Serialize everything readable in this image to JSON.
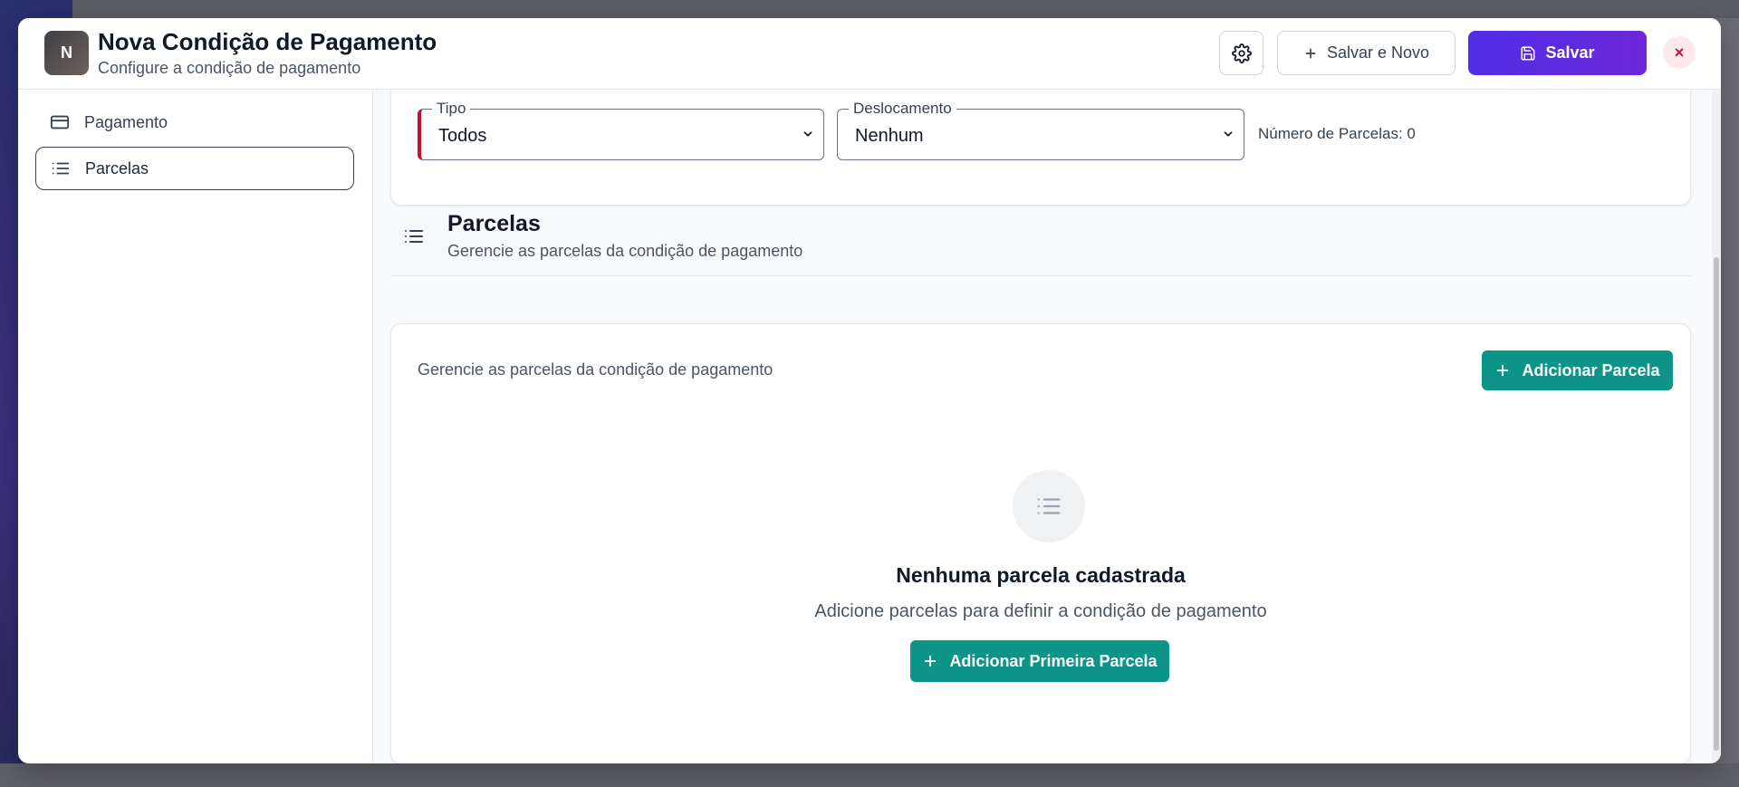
{
  "header": {
    "avatar_letter": "N",
    "title": "Nova Condição de Pagamento",
    "subtitle": "Configure a condição de pagamento",
    "save_new_label": "Salvar e Novo",
    "save_label": "Salvar",
    "close_label": "×"
  },
  "sidebar": {
    "items": [
      {
        "label": "Pagamento",
        "icon": "credit-card-icon",
        "active": false
      },
      {
        "label": "Parcelas",
        "icon": "list-icon",
        "active": true
      }
    ]
  },
  "filters": {
    "tipo": {
      "label": "Tipo",
      "value": "Todos"
    },
    "deslocamento": {
      "label": "Deslocamento",
      "value": "Nenhum"
    },
    "numero_parcelas": "Número de Parcelas: 0"
  },
  "section": {
    "title": "Parcelas",
    "subtitle": "Gerencie as parcelas da condição de pagamento"
  },
  "main": {
    "description": "Gerencie as parcelas da condição de pagamento",
    "add_button_label": "Adicionar Parcela",
    "empty_title": "Nenhuma parcela cadastrada",
    "empty_subtitle": "Adicione parcelas para definir a condição de pagamento",
    "add_first_label": "Adicionar Primeira Parcela"
  },
  "colors": {
    "primary": "#5b2ee6",
    "accent": "#0d9488",
    "danger": "#be123c"
  }
}
